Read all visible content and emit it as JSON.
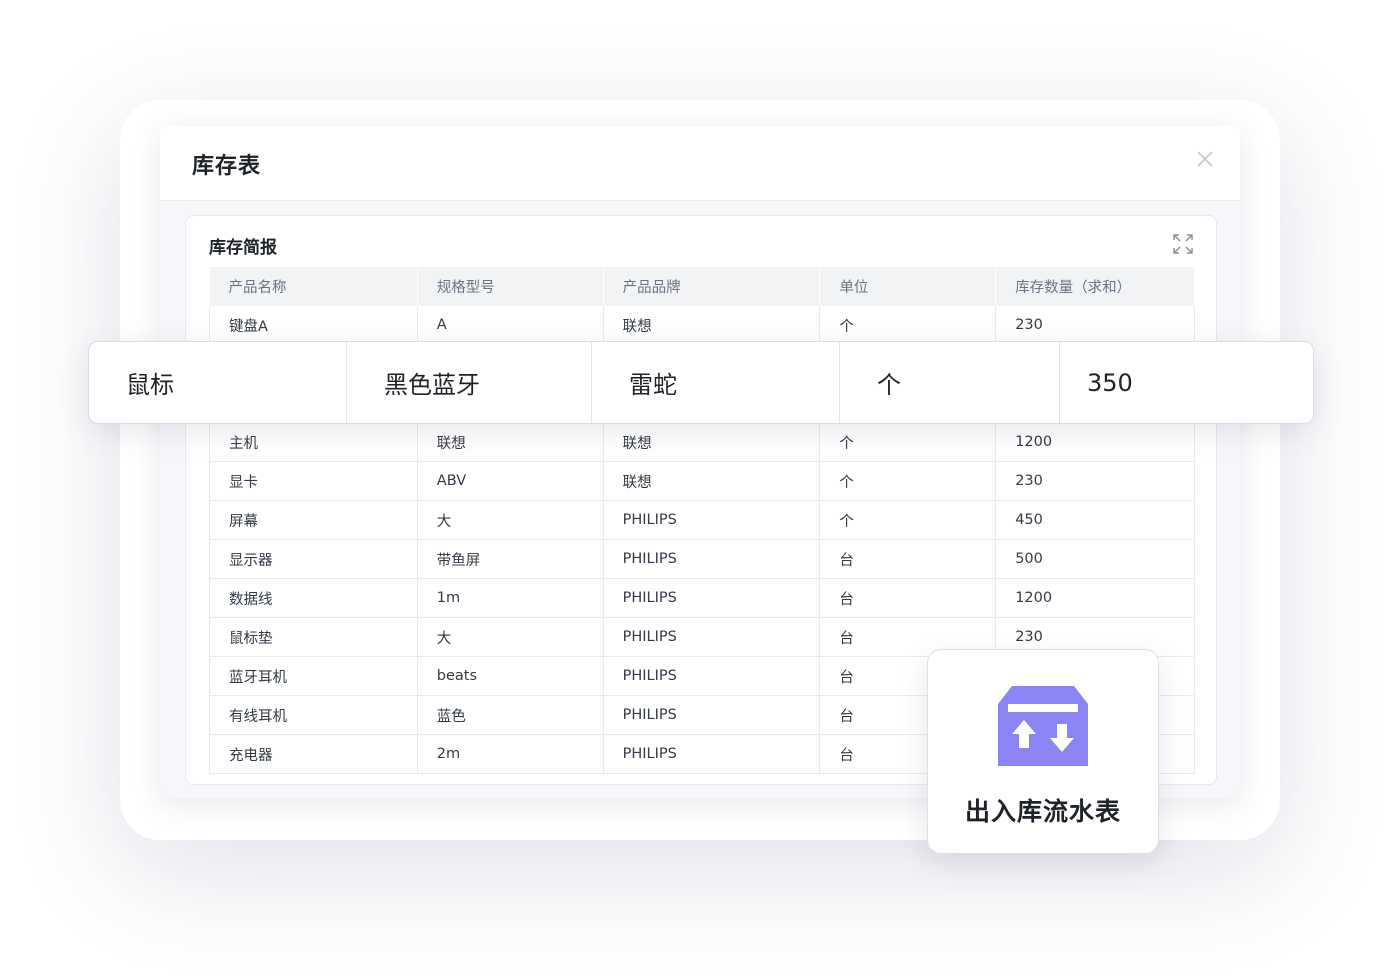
{
  "window": {
    "title": "库存表",
    "close_icon": "close-icon"
  },
  "card": {
    "title": "库存简报",
    "expand_icon": "expand-icon"
  },
  "table": {
    "columns": [
      "产品名称",
      "规格型号",
      "产品品牌",
      "单位",
      "库存数量（求和）"
    ],
    "rows": [
      [
        "键盘A",
        "A",
        "联想",
        "个",
        "230"
      ],
      [
        "鼠标",
        "黑色蓝牙",
        "雷蛇",
        "个",
        "350"
      ],
      [
        "主机",
        "联想",
        "联想",
        "个",
        "1200"
      ],
      [
        "显卡",
        "ABV",
        "联想",
        "个",
        "230"
      ],
      [
        "屏幕",
        "大",
        "PHILIPS",
        "个",
        "450"
      ],
      [
        "显示器",
        "带鱼屏",
        "PHILIPS",
        "台",
        "500"
      ],
      [
        "数据线",
        "1m",
        "PHILIPS",
        "台",
        "1200"
      ],
      [
        "鼠标垫",
        "大",
        "PHILIPS",
        "台",
        "230"
      ],
      [
        "蓝牙耳机",
        "beats",
        "PHILIPS",
        "台",
        ""
      ],
      [
        "有线耳机",
        "蓝色",
        "PHILIPS",
        "台",
        ""
      ],
      [
        "充电器",
        "2m",
        "PHILIPS",
        "台",
        ""
      ]
    ]
  },
  "highlight_row": [
    "鼠标",
    "黑色蓝牙",
    "雷蛇",
    "个",
    "350"
  ],
  "flow_badge": {
    "label": "出入库流水表",
    "icon": "inbound-outbound-box-icon",
    "icon_color": "#8b84f7"
  },
  "colors": {
    "accent": "#8b84f7",
    "header_bg": "#f2f3f5"
  }
}
